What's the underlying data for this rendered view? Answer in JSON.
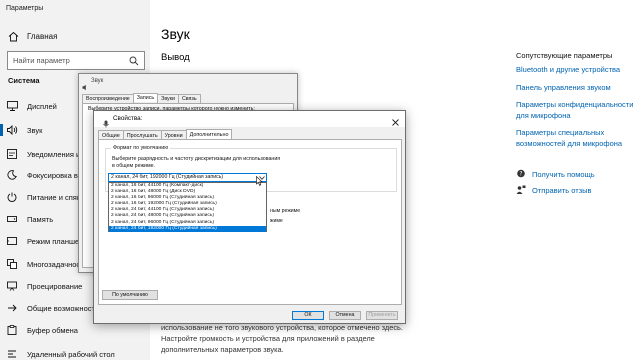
{
  "window": {
    "title": "Параметры"
  },
  "nav": {
    "home_label": "Главная",
    "search_placeholder": "Найти параметр",
    "section": "Система",
    "items": [
      {
        "label": "Дисплей",
        "icon": "monitor-icon"
      },
      {
        "label": "Звук",
        "icon": "speaker-icon",
        "active": true
      },
      {
        "label": "Уведомления и д",
        "icon": "notification-icon"
      },
      {
        "label": "Фокусировка вни",
        "icon": "moon-icon"
      },
      {
        "label": "Питание и спящ",
        "icon": "power-icon"
      },
      {
        "label": "Память",
        "icon": "storage-icon"
      },
      {
        "label": "Режим планшета",
        "icon": "tablet-icon"
      },
      {
        "label": "Многозадачност",
        "icon": "multitask-icon"
      },
      {
        "label": "Проецирование",
        "icon": "project-icon"
      },
      {
        "label": "Общие возможност",
        "icon": "shared-icon"
      },
      {
        "label": "Буфер обмена",
        "icon": "clipboard-icon"
      },
      {
        "label": "Удаленный рабочий стол",
        "icon": "remote-icon"
      }
    ]
  },
  "main": {
    "title": "Звук",
    "subtitle": "Вывод",
    "bottom_text": "использование не того звукового устройства, которое отмечено здесь. Настройте громкость и устройства для приложений в разделе дополнительных параметров звука."
  },
  "related": {
    "title": "Сопутствующие параметры",
    "links": [
      "Bluetooth и другие устройства",
      "Панель управления звуком",
      "Параметры конфиденциальности для микрофона",
      "Параметры специальных возможностей для микрофона"
    ],
    "help": "Получить помощь",
    "feedback": "Отправить отзыв"
  },
  "sound_dialog": {
    "title": "Звук",
    "tabs": [
      "Воспроизведение",
      "Запись",
      "Звуки",
      "Связь"
    ],
    "selected_tab": 1,
    "desc": "Выберите устройство записи, параметры которого нужно изменить:"
  },
  "props_dialog": {
    "title": "Свойства:",
    "tabs": [
      "Общие",
      "Прослушать",
      "Уровни",
      "Дополнительно"
    ],
    "selected_tab": 3,
    "group_label": "Формат по умолчанию",
    "group_desc": "Выберите разрядность и частоту дискретизации для использования в общем режиме.",
    "dropdown_value": "2 канал, 24 бит, 192000 Гц (Студийная запись)",
    "options": [
      "2 канал, 16 бит, 44100 Гц (Компакт-диск)",
      "2 канал, 16 бит, 48000 Гц (Диск DVD)",
      "2 канал, 16 бит, 96000 Гц (Студийная запись)",
      "2 канал, 16 бит, 192000 Гц (Студийная запись)",
      "2 канал, 24 бит, 44100 Гц (Студийная запись)",
      "2 канал, 24 бит, 48000 Гц (Студийная запись)",
      "2 канал, 24 бит, 96000 Гц (Студийная запись)",
      "2 канал, 24 бит, 192000 Гц (Студийная запись)"
    ],
    "highlighted_option": 7,
    "exclusive_text_1": "ным режиме",
    "exclusive_text_2": "жиме",
    "defaults_button": "По умолчанию",
    "ok": "ОК",
    "cancel": "Отмена",
    "apply": "Применить"
  },
  "colors": {
    "accent": "#0078d7",
    "link": "#0063b1",
    "nav_bg": "#f2f2f2"
  }
}
